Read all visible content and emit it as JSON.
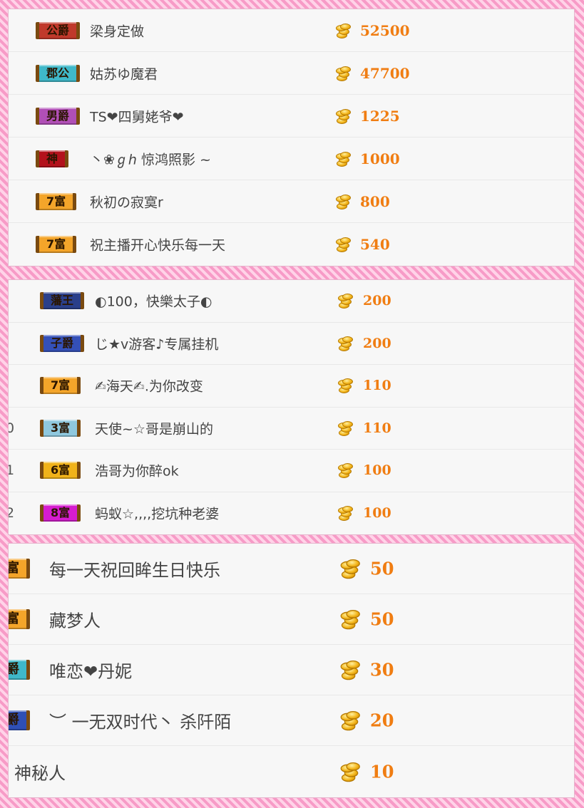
{
  "sections": [
    {
      "rows": [
        {
          "rank": "",
          "badge": "公爵",
          "badge_color": "#c0392b",
          "name": "梁身定做",
          "amount": "52500"
        },
        {
          "rank": "",
          "badge": "郡公",
          "badge_color": "#3fb8c9",
          "name": "姑苏ゆ魔君",
          "amount": "47700"
        },
        {
          "rank": "",
          "badge": "男爵",
          "badge_color": "#b04fb6",
          "name": "TS❤四舅姥爷❤",
          "amount": "1225"
        },
        {
          "rank": "",
          "badge": "神",
          "badge_color": "#b3121c",
          "name": "丶❀ℊℎ 惊鸿照影 ~",
          "amount": "1000"
        },
        {
          "rank": "",
          "badge": "7富",
          "badge_color": "#f4a52a",
          "name": "秋初の寂寞r",
          "amount": "800"
        },
        {
          "rank": "",
          "badge": "7富",
          "badge_color": "#f4a52a",
          "name": "祝主播开心快乐每一天",
          "amount": "540"
        }
      ]
    },
    {
      "rows": [
        {
          "rank": "",
          "badge": "藩王",
          "badge_color": "#2a3f8a",
          "name": "◐100，快樂太子◐",
          "amount": "200"
        },
        {
          "rank": "",
          "badge": "子爵",
          "badge_color": "#3450b8",
          "name": "じ★v游客♪专属挂机",
          "amount": "200"
        },
        {
          "rank": "",
          "badge": "7富",
          "badge_color": "#f4a52a",
          "name": "✍海天✍.为你改变",
          "amount": "110"
        },
        {
          "rank": "0",
          "badge": "3富",
          "badge_color": "#8fc8de",
          "name": "天使~☆哥是崩山的",
          "amount": "110"
        },
        {
          "rank": "1",
          "badge": "6富",
          "badge_color": "#f0b21a",
          "name": "浩哥为你醉ok",
          "amount": "100"
        },
        {
          "rank": "2",
          "badge": "8富",
          "badge_color": "#d61ccf",
          "name": "蚂蚁☆,,,,挖坑种老婆",
          "amount": "100"
        }
      ]
    },
    {
      "rows": [
        {
          "rank": "",
          "badge": "富",
          "badge_color": "#f4a52a",
          "name": "每一天祝回眸生日快乐",
          "amount": "50"
        },
        {
          "rank": "",
          "badge": "富",
          "badge_color": "#f4a52a",
          "name": "藏梦人",
          "amount": "50"
        },
        {
          "rank": "",
          "badge": "爵",
          "badge_color": "#3fb8c9",
          "name": "唯恋❤丹妮",
          "amount": "30"
        },
        {
          "rank": "",
          "badge": "爵",
          "badge_color": "#2f4fb5",
          "name": "︶ 一无双时代丶 杀阡陌",
          "amount": "20"
        },
        {
          "rank": "",
          "badge": "",
          "badge_color": "",
          "name": "神秘人",
          "amount": "10"
        }
      ]
    }
  ]
}
